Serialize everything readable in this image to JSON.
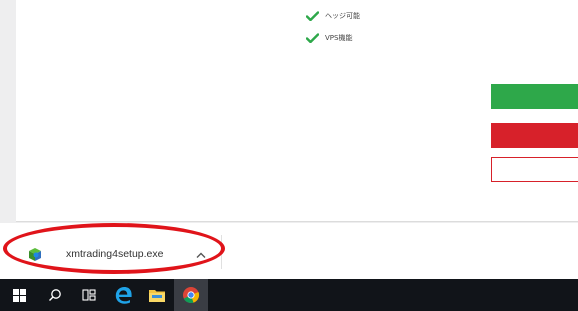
{
  "page": {
    "features": [
      {
        "label": "ヘッジ可能",
        "icon": "check-icon"
      },
      {
        "label": "VPS機能",
        "icon": "check-icon"
      }
    ],
    "colors": {
      "check": "#2ea84a",
      "cta_green": "#2ea84a",
      "cta_red": "#d7212a"
    }
  },
  "download_bar": {
    "file_name": "xmtrading4setup.exe",
    "file_icon": "installer-icon",
    "options_icon": "chevron-up-icon",
    "highlight_color": "#e0141a"
  },
  "taskbar": {
    "items": [
      "windows-start-icon",
      "search-icon",
      "task-view-icon",
      "edge-icon",
      "file-explorer-icon",
      "chrome-icon"
    ]
  }
}
